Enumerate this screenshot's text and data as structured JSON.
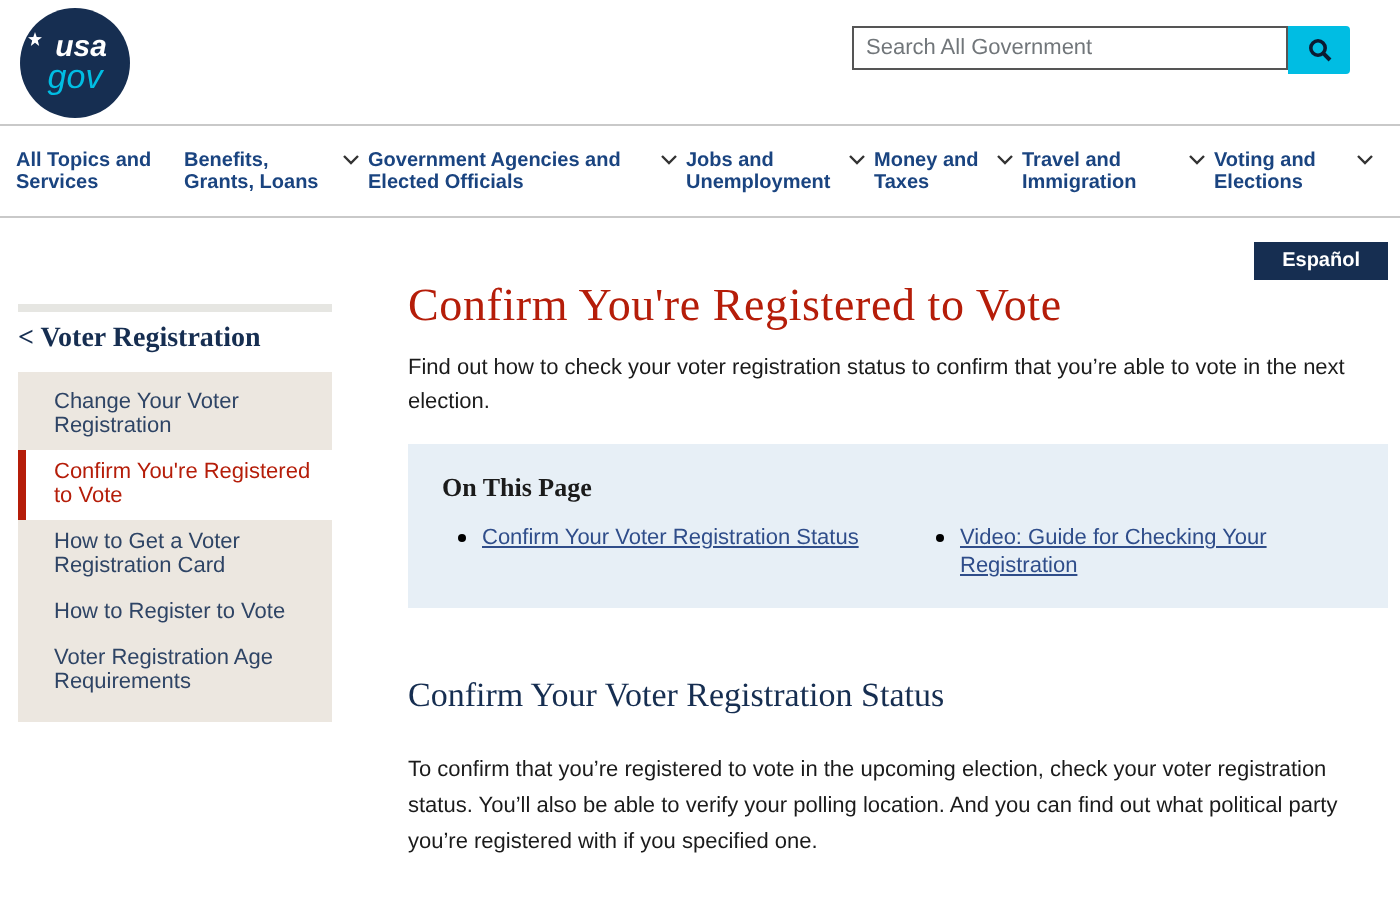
{
  "header": {
    "logo": {
      "top": "usa",
      "bottom": "gov"
    },
    "search": {
      "placeholder": "Search All Government"
    }
  },
  "nav": [
    {
      "label": "All Topics and Services",
      "kind": "link"
    },
    {
      "label": "Benefits, Grants, Loans",
      "kind": "dropdown"
    },
    {
      "label": "Government Agencies and Elected Officials",
      "kind": "dropdown"
    },
    {
      "label": "Jobs and Unemployment",
      "kind": "dropdown"
    },
    {
      "label": "Money and Taxes",
      "kind": "dropdown"
    },
    {
      "label": "Travel and Immigration",
      "kind": "dropdown"
    },
    {
      "label": "Voting and Elections",
      "kind": "dropdown"
    }
  ],
  "language_button": "Español",
  "sidebar": {
    "back_link": "< Voter Registration",
    "items": [
      {
        "label": "Change Your Voter Registration",
        "selected": false
      },
      {
        "label": "Confirm You're Registered to Vote",
        "selected": true
      },
      {
        "label": "How to Get a Voter Registration Card",
        "selected": false
      },
      {
        "label": "How to Register to Vote",
        "selected": false
      },
      {
        "label": "Voter Registration Age Requirements",
        "selected": false
      }
    ]
  },
  "main": {
    "title": "Confirm You're Registered to Vote",
    "intro": "Find out how to check your voter registration status to confirm that you’re able to vote in the next election.",
    "on_this_page": {
      "heading": "On This Page",
      "links": [
        "Confirm Your Voter Registration Status",
        "Video: Guide for Checking Your Registration"
      ]
    },
    "section_heading": "Confirm Your Voter Registration Status",
    "section_text": "To confirm that you’re registered to vote in the upcoming election, check your voter registration status. You’ll also be able to verify your polling location. And you can find out what political party you’re registered with if you specified one."
  }
}
